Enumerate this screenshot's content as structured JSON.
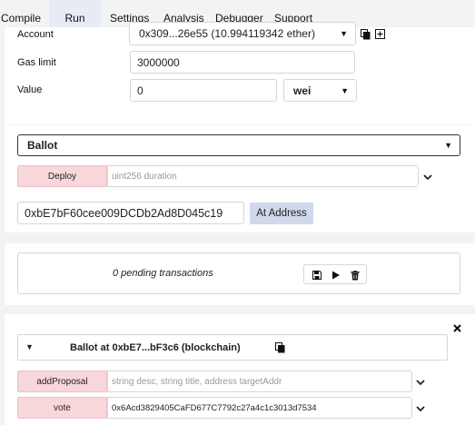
{
  "tabs": [
    "Compile",
    "Run",
    "Settings",
    "Analysis",
    "Debugger",
    "Support"
  ],
  "account": {
    "label": "Account",
    "value": "0x309...26e55 (10.994119342 ether)"
  },
  "gas_limit": {
    "label": "Gas limit",
    "value": "3000000"
  },
  "value": {
    "label": "Value",
    "amount": "0",
    "unit": "wei"
  },
  "contract": {
    "selected": "Ballot"
  },
  "deploy": {
    "label": "Deploy",
    "placeholder": "uint256 duration"
  },
  "at_address": {
    "value": "0xbE7bF60cee009DCDb2Ad8D045c19",
    "label": "At Address"
  },
  "pending": {
    "text": "0 pending transactions"
  },
  "instance": {
    "title": "Ballot at 0xbE7...bF3c6 (blockchain)",
    "functions": [
      {
        "label": "addProposal",
        "placeholder": "string desc, string title, address targetAddr",
        "value": ""
      },
      {
        "label": "vote",
        "placeholder": "",
        "value": "0x6Acd3829405CaFD677C7792c27a4c1c3013d7534"
      }
    ]
  },
  "colors": {
    "accent": "#e6ebf4",
    "danger_btn": "#f8d7db",
    "background": "#f2f3f5"
  }
}
